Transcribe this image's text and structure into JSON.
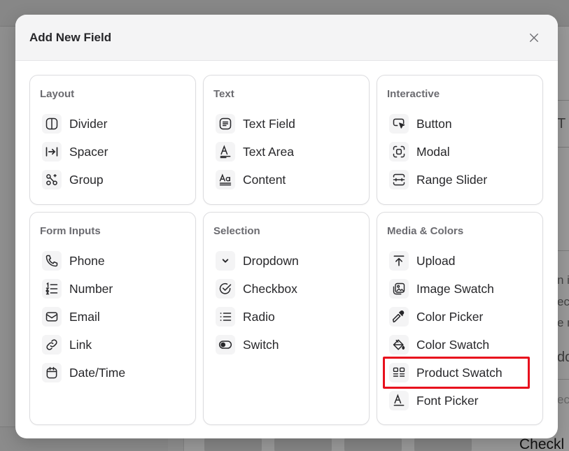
{
  "modal": {
    "title": "Add New Field",
    "close_icon": "close-icon"
  },
  "categories": [
    {
      "title": "Layout",
      "items": [
        {
          "label": "Divider",
          "icon": "divider-icon"
        },
        {
          "label": "Spacer",
          "icon": "spacer-icon"
        },
        {
          "label": "Group",
          "icon": "group-icon"
        }
      ]
    },
    {
      "title": "Text",
      "items": [
        {
          "label": "Text Field",
          "icon": "text-field-icon"
        },
        {
          "label": "Text Area",
          "icon": "text-area-icon"
        },
        {
          "label": "Content",
          "icon": "content-icon"
        }
      ]
    },
    {
      "title": "Interactive",
      "items": [
        {
          "label": "Button",
          "icon": "button-cursor-icon"
        },
        {
          "label": "Modal",
          "icon": "modal-icon"
        },
        {
          "label": "Range Slider",
          "icon": "range-slider-icon"
        }
      ]
    },
    {
      "title": "Form Inputs",
      "items": [
        {
          "label": "Phone",
          "icon": "phone-icon"
        },
        {
          "label": "Number",
          "icon": "numbered-list-icon"
        },
        {
          "label": "Email",
          "icon": "mail-icon"
        },
        {
          "label": "Link",
          "icon": "link-icon"
        },
        {
          "label": "Date/Time",
          "icon": "calendar-icon"
        }
      ]
    },
    {
      "title": "Selection",
      "items": [
        {
          "label": "Dropdown",
          "icon": "chevron-down-icon"
        },
        {
          "label": "Checkbox",
          "icon": "check-circle-icon"
        },
        {
          "label": "Radio",
          "icon": "list-icon"
        },
        {
          "label": "Switch",
          "icon": "toggle-icon"
        }
      ]
    },
    {
      "title": "Media & Colors",
      "items": [
        {
          "label": "Upload",
          "icon": "upload-icon"
        },
        {
          "label": "Image Swatch",
          "icon": "image-swatch-icon"
        },
        {
          "label": "Color Picker",
          "icon": "eyedropper-icon"
        },
        {
          "label": "Color Swatch",
          "icon": "paint-bucket-icon"
        },
        {
          "label": "Product Swatch",
          "icon": "product-swatch-icon",
          "highlighted": true
        },
        {
          "label": "Font Picker",
          "icon": "font-icon"
        }
      ]
    }
  ],
  "colors": {
    "highlight": "#e8101d",
    "text": "#27272a",
    "category_title": "#6b6b70"
  },
  "background_fragments": [
    "T",
    "n i",
    "ec",
    "e n",
    "do",
    "ect",
    "Checkl"
  ]
}
